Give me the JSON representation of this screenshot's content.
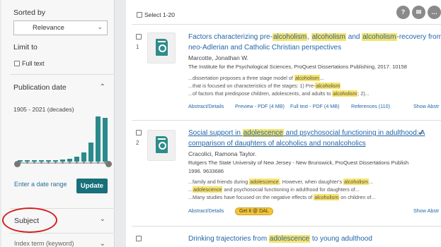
{
  "sidebar": {
    "sorted_by_label": "Sorted by",
    "sort_value": "Relevance",
    "limit_to_label": "Limit to",
    "full_text_label": "Full text",
    "publication_date_label": "Publication date",
    "decades_label": "1905 - 2021 (decades)",
    "histogram_values": [
      0.03,
      0.03,
      0.03,
      0.03,
      0.03,
      0.03,
      0.04,
      0.06,
      0.1,
      0.2,
      0.4,
      0.95,
      0.92
    ],
    "date_range_link": "Enter a date range",
    "update_button": "Update",
    "subject_label": "Subject",
    "index_term_label": "Index term (keyword)"
  },
  "main": {
    "select_label": "Select 1-20",
    "top_icons": [
      "?",
      "✉",
      "…"
    ],
    "results": [
      {
        "number": "1",
        "title_parts": [
          {
            "t": "Factors characterizing pre-",
            "h": false
          },
          {
            "t": "alcoholism",
            "h": true
          },
          {
            "t": ", ",
            "h": false
          },
          {
            "t": "alcoholism",
            "h": true
          },
          {
            "t": " and ",
            "h": false
          },
          {
            "t": "alcoholism",
            "h": true
          },
          {
            "t": "-recovery from",
            "h": false
          }
        ],
        "title_line2": "neo-Adlerian and Catholic Christian perspectives",
        "author": "Marcotte, Jonathan W.",
        "source": "The Institute for the Psychological Sciences, ProQuest Dissertations Publishing, 2017. 10158",
        "snippets": [
          [
            {
              "t": "...dissertation proposes a three stage model of ",
              "h": false
            },
            {
              "t": "alcoholism",
              "h": true
            },
            {
              "t": "...",
              "h": false
            }
          ],
          [
            {
              "t": "...that is focused on characteristics of the stages: 1) Pre-",
              "h": false
            },
            {
              "t": "alcoholism",
              "h": true
            }
          ],
          [
            {
              "t": "...of factors that predispose children, adolescents, and adults to ",
              "h": false
            },
            {
              "t": "alcoholism",
              "h": true
            },
            {
              "t": "; 2)...",
              "h": false
            }
          ]
        ],
        "links": {
          "abstract": "Abstract/Details",
          "preview": "Preview - PDF (4 MB)",
          "fulltext": "Full text - PDF (4 MB)",
          "references": "References (110)",
          "show_abstract": "Show Abstr"
        }
      },
      {
        "number": "2",
        "title_parts": [
          {
            "t": "Social support in ",
            "h": false
          },
          {
            "t": "adolescence",
            "h": true
          },
          {
            "t": " and psychosocial functioning in adulthood: A",
            "h": false
          }
        ],
        "title_line2": "comparison of daughters of alcoholics and nonalcoholics",
        "author": "Cracolici, Ramona Taylor.",
        "source": "Rutgers The State University of New Jersey - New Brunswick, ProQuest Dissertations Publish",
        "source2": "1996. 9633686",
        "snippets": [
          [
            {
              "t": "...family and friends during ",
              "h": false
            },
            {
              "t": "adolescence",
              "h": true
            },
            {
              "t": ". However, when daughter's ",
              "h": false
            },
            {
              "t": "alcoholism",
              "h": true
            },
            {
              "t": "...",
              "h": false
            }
          ],
          [
            {
              "t": "...",
              "h": false
            },
            {
              "t": "adolescence",
              "h": true
            },
            {
              "t": " and psychosocial functioning in adulthood for daughters of...",
              "h": false
            }
          ],
          [
            {
              "t": "...Many studies have focused on the negative effects of ",
              "h": false
            },
            {
              "t": "alcoholism",
              "h": true
            },
            {
              "t": " on children of...",
              "h": false
            }
          ]
        ],
        "links": {
          "abstract": "Abstract/Details",
          "getit": "Get It @ DAL",
          "show_abstract": "Show Abstr"
        }
      },
      {
        "number": "",
        "title_parts": [
          {
            "t": "Drinking trajectories from ",
            "h": false
          },
          {
            "t": "adolescence",
            "h": true
          },
          {
            "t": " to young adulthood",
            "h": false
          }
        ]
      }
    ]
  },
  "colors": {
    "accent": "#17707a",
    "histogram": "#2a8a8c",
    "highlight": "#f6e36c",
    "link": "#2366a8",
    "annotation": "#d32020"
  }
}
